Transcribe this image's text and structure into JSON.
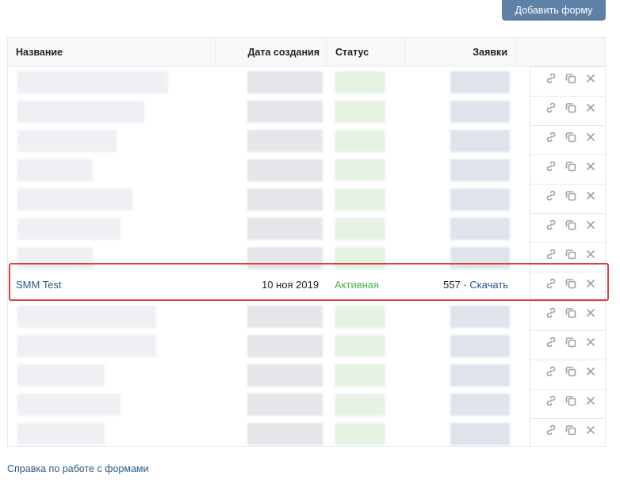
{
  "header": {
    "add_form_label": "Добавить форму"
  },
  "table": {
    "columns": {
      "name": "Название",
      "date": "Дата создания",
      "status": "Статус",
      "applications": "Заявки"
    },
    "highlighted_row": {
      "name": "SMM Test",
      "date": "10 ноя 2019",
      "status": "Активная",
      "applications_count": "557",
      "separator": " · ",
      "download_label": "Скачать"
    },
    "action_icons": [
      "link-icon",
      "copy-icon",
      "close-icon"
    ]
  },
  "footer": {
    "help_link": "Справка по работе с формами"
  },
  "colors": {
    "accent": "#5e81a8",
    "link": "#2a5885",
    "active_status": "#4bb34b",
    "highlight_border": "#d9413e"
  }
}
